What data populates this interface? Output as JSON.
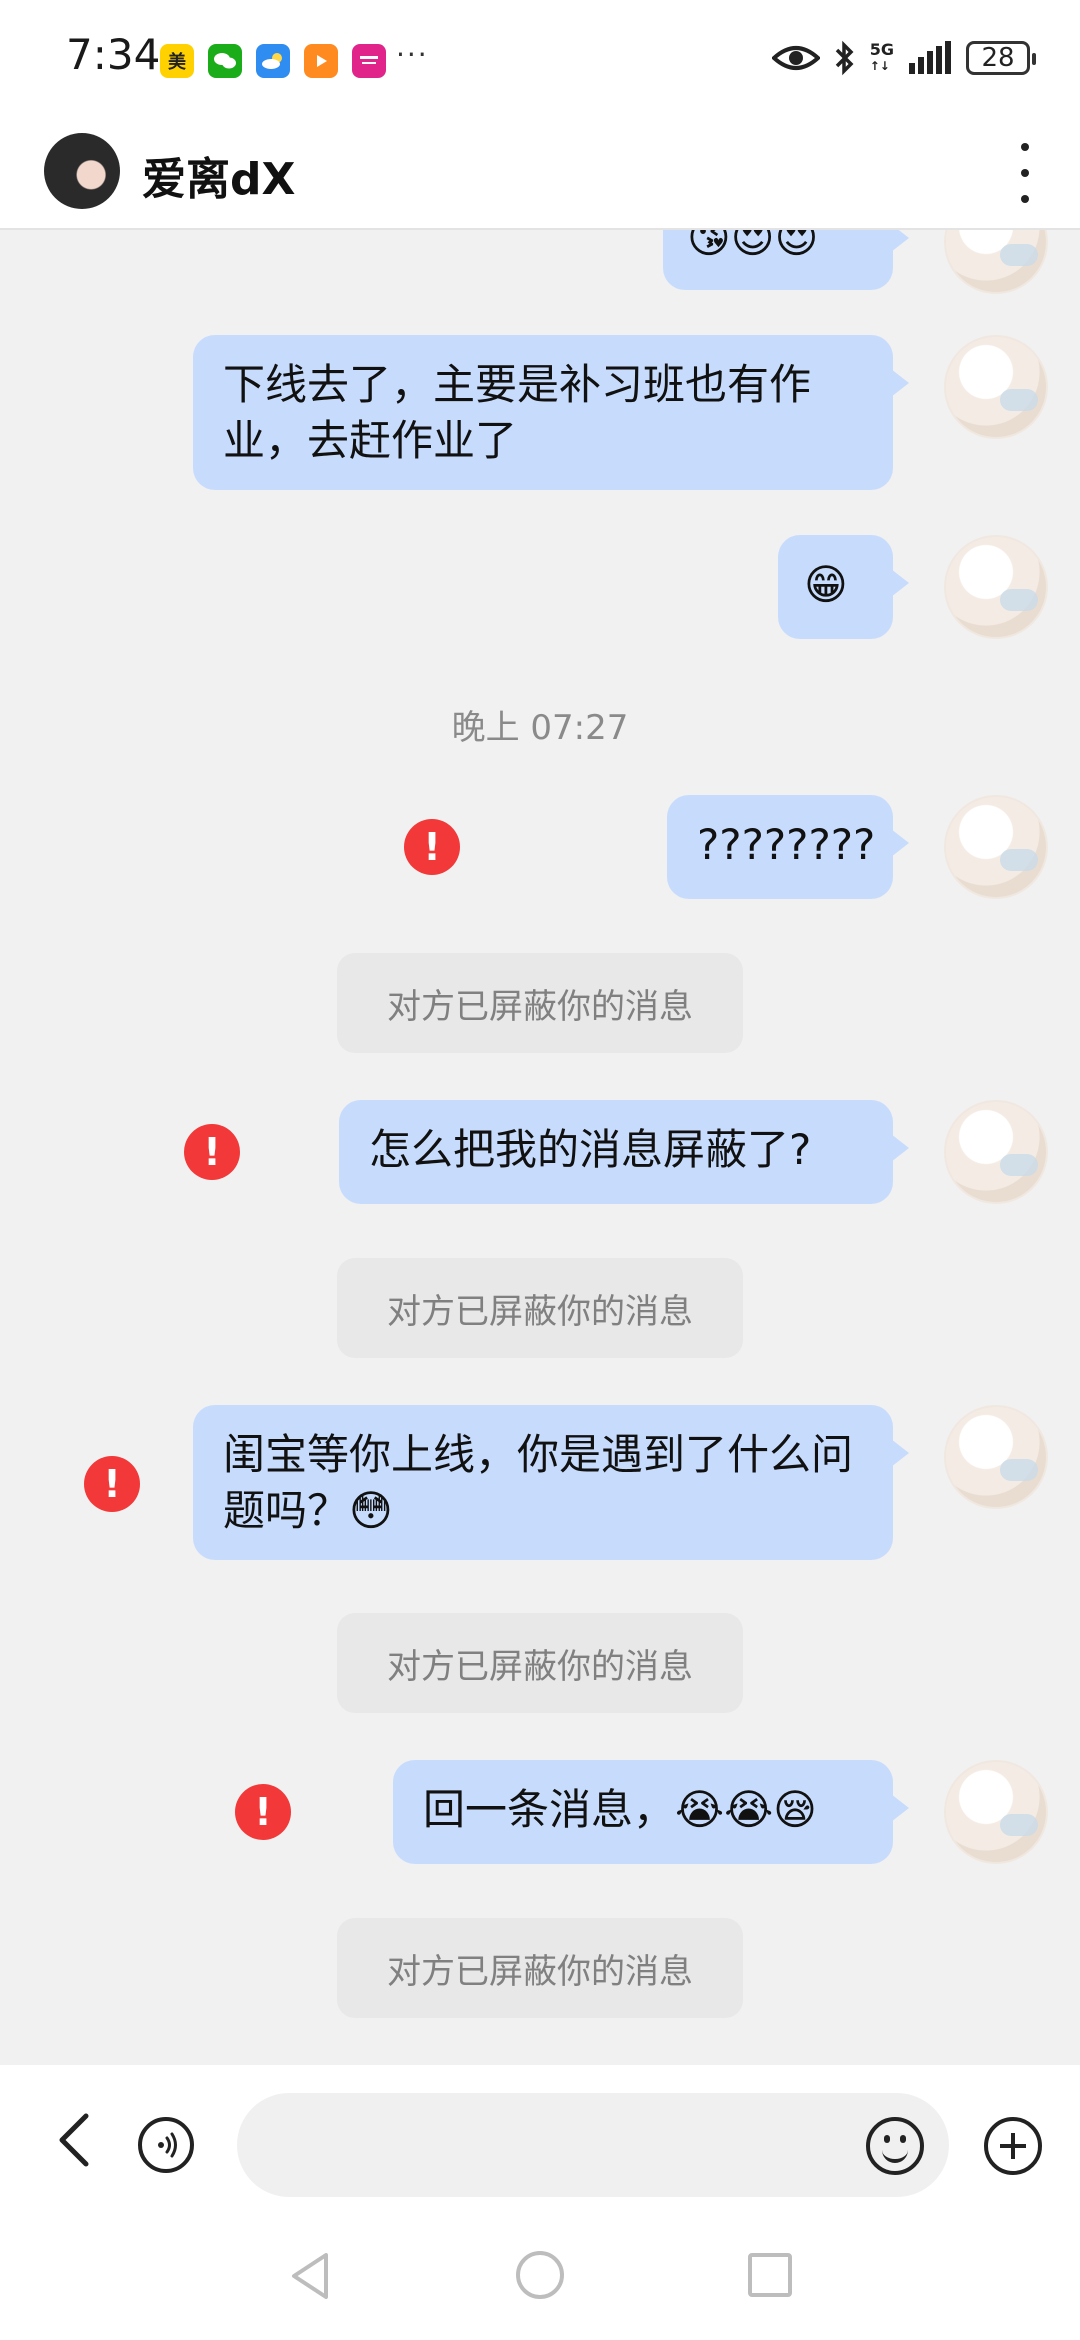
{
  "status_bar": {
    "time": "7:34",
    "app_icons": [
      {
        "name": "meituan-icon",
        "label": "美",
        "color": "#ffd100",
        "text_color": "#222222"
      },
      {
        "name": "wechat-icon",
        "label": "",
        "color": "#1aad19"
      },
      {
        "name": "weather-icon",
        "label": "",
        "color": "#2f8cf0"
      },
      {
        "name": "video-icon",
        "label": "",
        "color": "#ff8a1f"
      },
      {
        "name": "shop-icon",
        "label": "",
        "color": "#e0248a"
      }
    ],
    "more": "···",
    "network": "5G",
    "battery": "28"
  },
  "header": {
    "title": "爱离dX"
  },
  "messages": [
    {
      "type": "outgoing",
      "text": "😘😍😍",
      "partial": true
    },
    {
      "type": "outgoing",
      "text": "下线去了，主要是补习班也有作业，去赶作业了"
    },
    {
      "type": "outgoing",
      "text": "😁"
    },
    {
      "type": "time",
      "text": "晚上 07:27"
    },
    {
      "type": "outgoing",
      "text": "????????",
      "failed": true
    },
    {
      "type": "system",
      "text": "对方已屏蔽你的消息"
    },
    {
      "type": "outgoing",
      "text": "怎么把我的消息屏蔽了?",
      "failed": true
    },
    {
      "type": "system",
      "text": "对方已屏蔽你的消息"
    },
    {
      "type": "outgoing",
      "text": "闺宝等你上线，你是遇到了什么问题吗？😳",
      "failed": true
    },
    {
      "type": "system",
      "text": "对方已屏蔽你的消息"
    },
    {
      "type": "outgoing",
      "text": "回一条消息，😭😭😪",
      "failed": true
    },
    {
      "type": "system",
      "text": "对方已屏蔽你的消息"
    }
  ],
  "input_bar": {
    "placeholder": ""
  },
  "colors": {
    "bubble": "#c7dcfc",
    "error": "#f23838",
    "background": "#f1f1f1"
  }
}
